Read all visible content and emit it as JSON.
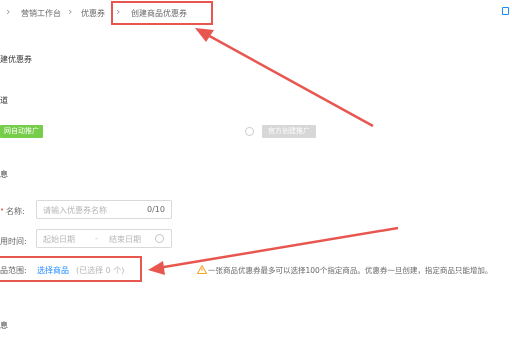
{
  "breadcrumb": {
    "item1": "营销工作台",
    "item2": "优惠券",
    "item3": "创建商品优惠券"
  },
  "page": {
    "heading": "建优惠券",
    "section_channel": "道",
    "btn_auto": "网自动推广",
    "btn_manual": "官方创建推广",
    "section_info": "息",
    "section_bottom": "息"
  },
  "form": {
    "name_label": "名称:",
    "name_placeholder": "请输入优惠券名称",
    "name_counter": "0/10",
    "time_label": "用时间:",
    "start_placeholder": "起始日期",
    "separator": "-",
    "end_placeholder": "结束日期",
    "range_label": "品范围:",
    "select_link": "选择商品",
    "selected_count": "(已选择 0 个)"
  },
  "warning": {
    "text": "一张商品优惠券最多可以选择100个指定商品。优惠券一旦创建，指定商品只能增加。"
  },
  "colors": {
    "annotation_red": "#e8574f",
    "link_blue": "#1e8cff",
    "green": "#76cd4a",
    "warning_orange": "#f5a623"
  }
}
